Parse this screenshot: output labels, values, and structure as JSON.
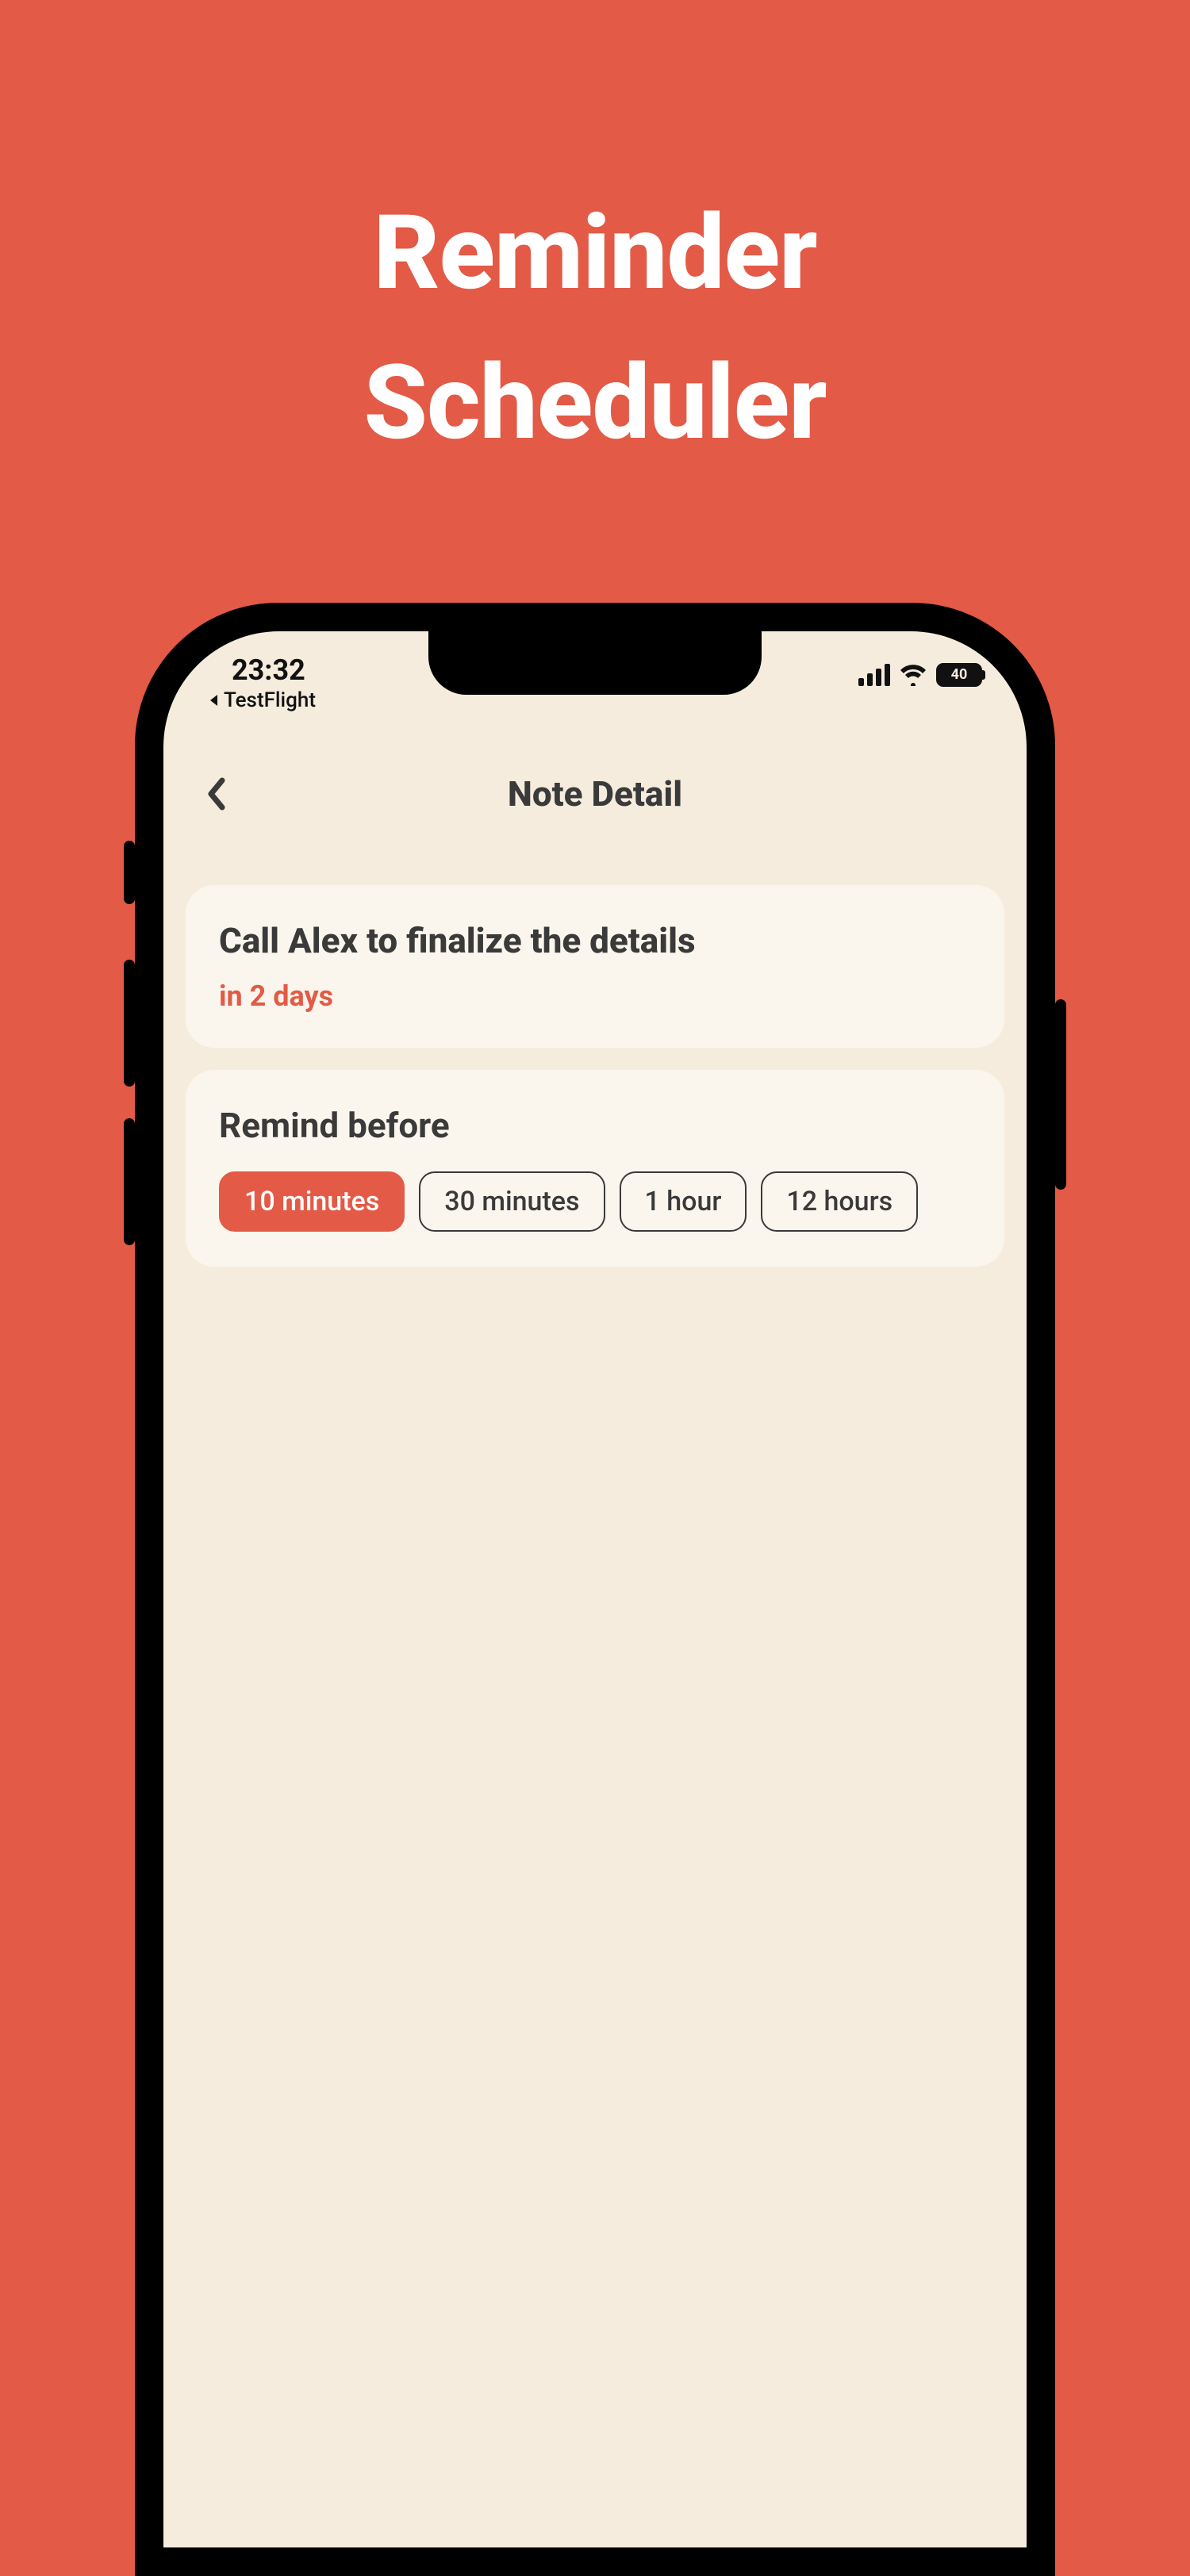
{
  "promo": {
    "title_line1": "Reminder",
    "title_line2": "Scheduler"
  },
  "status": {
    "time": "23:32",
    "back_app": "TestFlight",
    "battery_pct": "40"
  },
  "nav": {
    "title": "Note Detail"
  },
  "note": {
    "title": "Call Alex to finalize the details",
    "due": "in 2 days"
  },
  "remind": {
    "title": "Remind before",
    "options": [
      {
        "label": "10 minutes",
        "selected": true
      },
      {
        "label": "30 minutes",
        "selected": false
      },
      {
        "label": "1 hour",
        "selected": false
      },
      {
        "label": "12 hours",
        "selected": false
      }
    ]
  }
}
